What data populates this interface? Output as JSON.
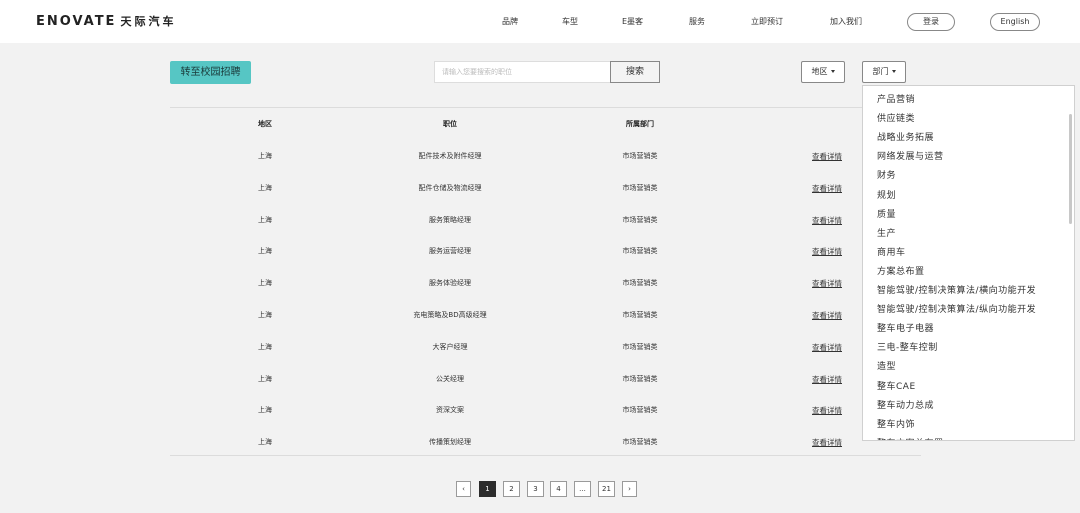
{
  "header": {
    "logo": "ENOVATE",
    "logo_cn": "天际汽车",
    "nav": [
      "品牌",
      "车型",
      "E墨客",
      "服务",
      "立即预订",
      "加入我们"
    ],
    "login": "登录",
    "language": "English"
  },
  "toolbar": {
    "campus_button": "转至校园招聘",
    "search_placeholder": "请输入您要搜索的职位",
    "search_button": "搜索",
    "region_filter": "地区",
    "dept_filter": "部门"
  },
  "table": {
    "headers": [
      "地区",
      "职位",
      "所属部门"
    ],
    "link_label": "查看详情",
    "rows": [
      {
        "region": "上海",
        "position": "配件技术及附件经理",
        "dept": "市场营销类"
      },
      {
        "region": "上海",
        "position": "配件仓储及物流经理",
        "dept": "市场营销类"
      },
      {
        "region": "上海",
        "position": "服务策略经理",
        "dept": "市场营销类"
      },
      {
        "region": "上海",
        "position": "服务运营经理",
        "dept": "市场营销类"
      },
      {
        "region": "上海",
        "position": "服务体验经理",
        "dept": "市场营销类"
      },
      {
        "region": "上海",
        "position": "充电策略及BD高级经理",
        "dept": "市场营销类"
      },
      {
        "region": "上海",
        "position": "大客户经理",
        "dept": "市场营销类"
      },
      {
        "region": "上海",
        "position": "公关经理",
        "dept": "市场营销类"
      },
      {
        "region": "上海",
        "position": "资深文案",
        "dept": "市场营销类"
      },
      {
        "region": "上海",
        "position": "传播策划经理",
        "dept": "市场营销类"
      }
    ]
  },
  "dept_menu": {
    "items": [
      "产品营销",
      "供应链类",
      "战略业务拓展",
      "网络发展与运营",
      "财务",
      "规划",
      "质量",
      "生产",
      "商用车",
      "方案总布置",
      "智能驾驶/控制决策算法/横向功能开发",
      "智能驾驶/控制决策算法/纵向功能开发",
      "整车电子电器",
      "三电-整车控制",
      "造型",
      "整车CAE",
      "整车动力总成",
      "整车内饰",
      "整车方案总布置"
    ]
  },
  "pagination": {
    "prev": "‹",
    "pages": [
      "1",
      "2",
      "3",
      "4",
      "...",
      "21"
    ],
    "next": "›",
    "current": "1"
  },
  "colors": {
    "accent": "#56c6c4",
    "active_page": "#2c2c2c",
    "background": "#f2f2f2"
  }
}
